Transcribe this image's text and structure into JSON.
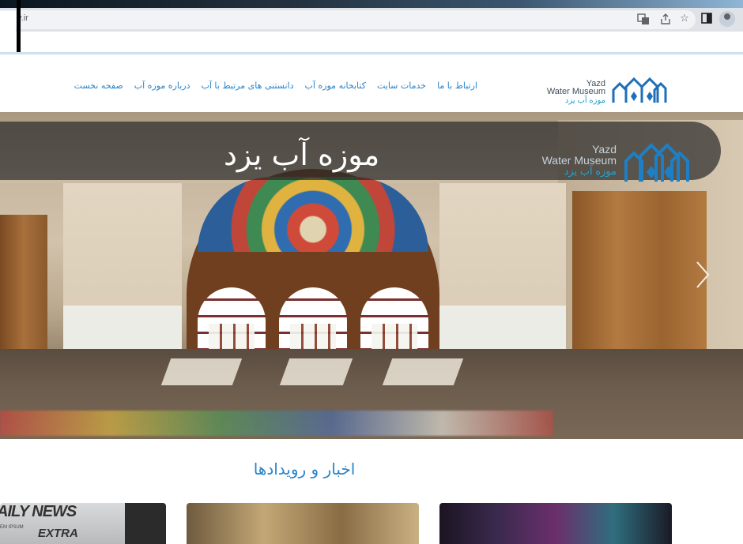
{
  "browser": {
    "url": "y.ir",
    "icons": [
      "translate-icon",
      "share-icon",
      "star-icon",
      "sidebar-icon",
      "profile-icon"
    ]
  },
  "site": {
    "logo": {
      "en_line1": "Yazd",
      "en_line2": "Water Museum",
      "fa": "موزه آب یزد"
    },
    "nav": [
      {
        "label": "صفحه نخست"
      },
      {
        "label": "درباره موزه آب"
      },
      {
        "label": "دانستنی های مرتبط با آب"
      },
      {
        "label": "کتابخانه موزه آب"
      },
      {
        "label": "خدمات سایت"
      },
      {
        "label": "ارتباط با ما"
      }
    ],
    "accent": "#2a84c9"
  },
  "hero": {
    "title": "موزه آب یزد",
    "logo_en_line1": "Yazd",
    "logo_en_line2": "Water Museum",
    "logo_fa": "موزه آب یزد"
  },
  "news": {
    "heading": "اخبار و رویدادها",
    "card1_text1": "AILY NEWS",
    "card1_text2": "EXTRA",
    "card1_text3": "EM IPSUM"
  }
}
